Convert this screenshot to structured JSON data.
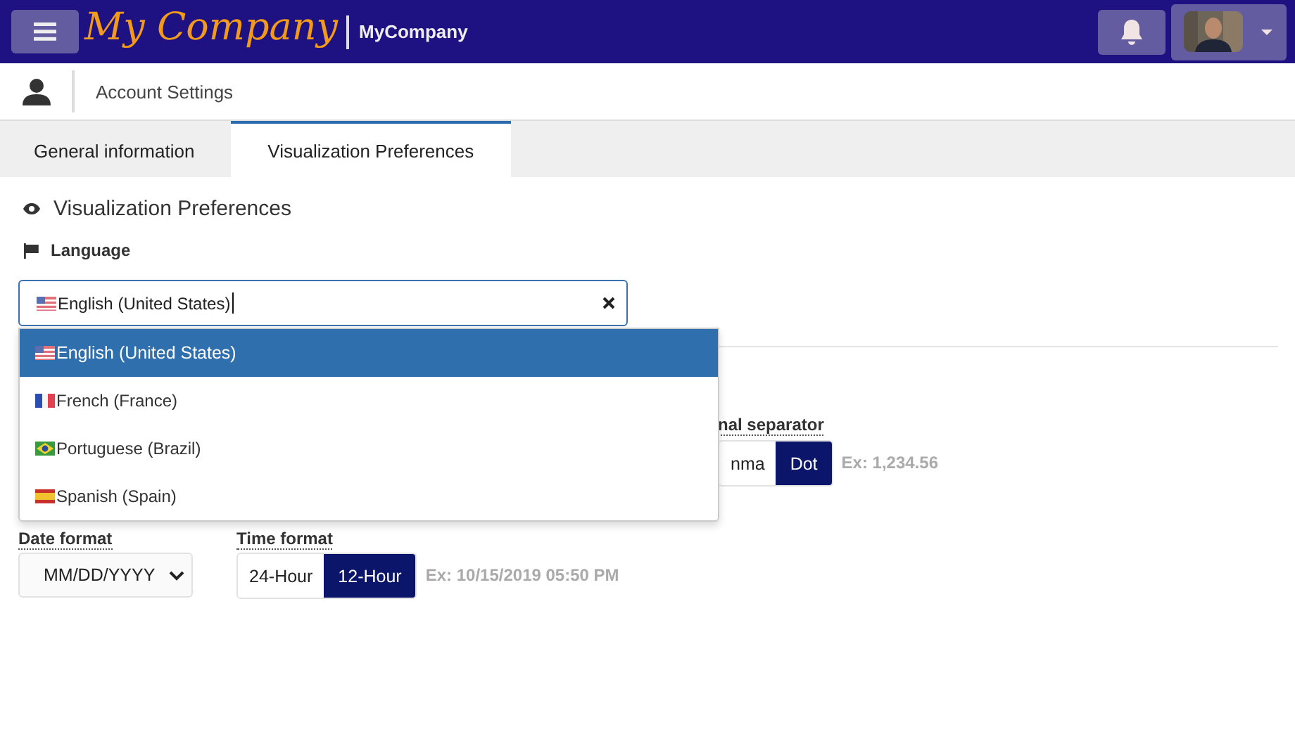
{
  "header": {
    "logo": "My Company",
    "company": "MyCompany"
  },
  "breadcrumb": {
    "title": "Account Settings"
  },
  "tabs": [
    {
      "label": "General information",
      "selected": false
    },
    {
      "label": "Visualization Preferences",
      "selected": true
    }
  ],
  "section": {
    "title": "Visualization Preferences"
  },
  "language": {
    "label": "Language",
    "value": {
      "label": "English (United States)",
      "kind": "us"
    },
    "options": [
      {
        "label": "English (United States)",
        "kind": "us",
        "selected": true
      },
      {
        "label": "French (France)",
        "kind": "fr",
        "selected": false
      },
      {
        "label": "Portuguese (Brazil)",
        "kind": "br",
        "selected": false
      },
      {
        "label": "Spanish (Spain)",
        "kind": "es",
        "selected": false
      }
    ]
  },
  "decimal_separator": {
    "label": "nal separator",
    "options": [
      {
        "label": "nma",
        "selected": false
      },
      {
        "label": "Dot",
        "selected": true
      }
    ],
    "example": "Ex: 1,234.56"
  },
  "date_format": {
    "label": "Date format",
    "value": "MM/DD/YYYY"
  },
  "time_format": {
    "label": "Time format",
    "options": [
      {
        "label": "24-Hour",
        "selected": false
      },
      {
        "label": "12-Hour",
        "selected": true
      }
    ],
    "example": "Ex: 10/15/2019 05:50 PM"
  }
}
